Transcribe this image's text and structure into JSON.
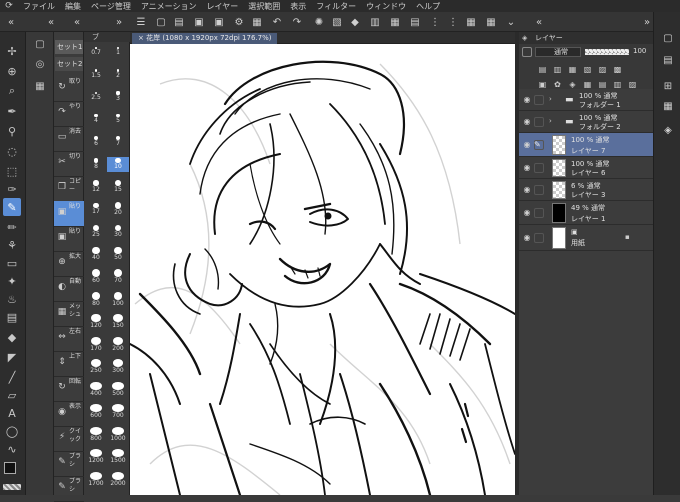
{
  "menu": [
    "ファイル",
    "編集",
    "ページ管理",
    "アニメーション",
    "レイヤー",
    "選択範囲",
    "表示",
    "フィルター",
    "ウィンドウ",
    "ヘルプ"
  ],
  "canvas_tab": "花岸 (1080 x 1920px 72dpi 176.7%)",
  "tool_property_tabs": [
    "セット1",
    "セット2"
  ],
  "sub_tools": [
    {
      "label": "取り",
      "icon": "rotate-icon"
    },
    {
      "label": "やり",
      "icon": "redo-icon"
    },
    {
      "label": "消去",
      "icon": "eraser-icon"
    },
    {
      "label": "切り",
      "icon": "scissors-icon"
    },
    {
      "label": "コピー",
      "icon": "copy-icon"
    },
    {
      "label": "貼り",
      "icon": "paste-icon",
      "active": true
    },
    {
      "label": "貼り",
      "icon": "paste-icon"
    },
    {
      "label": "拡大",
      "icon": "zoom-icon"
    },
    {
      "label": "自動",
      "icon": "auto-icon"
    },
    {
      "label": "メッシュ",
      "icon": "mesh-icon"
    },
    {
      "label": "左右",
      "icon": "flip-h-icon"
    },
    {
      "label": "上下",
      "icon": "flip-v-icon"
    },
    {
      "label": "回転",
      "icon": "rotate-icon"
    },
    {
      "label": "表示",
      "icon": "view-icon"
    },
    {
      "label": "クイック",
      "icon": "quick-icon"
    },
    {
      "label": "ブラシ",
      "icon": "brush-icon"
    },
    {
      "label": "ブラシ",
      "icon": "brush-icon"
    }
  ],
  "brush_sizes": [
    "0.7",
    "1",
    "1.5",
    "2",
    "2.5",
    "3",
    "4",
    "5",
    "6",
    "7",
    "8",
    "10",
    "12",
    "15",
    "17",
    "20",
    "25",
    "30",
    "40",
    "50",
    "60",
    "70",
    "80",
    "100",
    "120",
    "150",
    "170",
    "200",
    "250",
    "300",
    "400",
    "500",
    "600",
    "700",
    "800",
    "1000",
    "1200",
    "1500",
    "1700",
    "2000"
  ],
  "brush_selected": "10",
  "layers_title": "レイヤー",
  "blend_mode": "通常",
  "opacity": "100",
  "layers": [
    {
      "opacity": "100 %",
      "mode": "通常",
      "name": "フォルダー 1",
      "type": "folder",
      "selected": false
    },
    {
      "opacity": "100 %",
      "mode": "通常",
      "name": "フォルダー 2",
      "type": "folder",
      "selected": false
    },
    {
      "opacity": "100 %",
      "mode": "通常",
      "name": "レイヤー 7",
      "type": "raster",
      "thumb": "check",
      "selected": true
    },
    {
      "opacity": "100 %",
      "mode": "通常",
      "name": "レイヤー 6",
      "type": "raster",
      "thumb": "check",
      "selected": false
    },
    {
      "opacity": "6 %",
      "mode": "通常",
      "name": "レイヤー 3",
      "type": "raster",
      "thumb": "check",
      "selected": false
    },
    {
      "opacity": "49 %",
      "mode": "通常",
      "name": "レイヤー 1",
      "type": "raster",
      "thumb": "black",
      "selected": false
    },
    {
      "opacity": "",
      "mode": "",
      "name": "用紙",
      "type": "paper",
      "thumb": "white",
      "selected": false
    }
  ],
  "colors": {
    "accent": "#5a8dd6",
    "selected_layer": "#5a6f9c",
    "panel": "#3c3c3c",
    "canvas": "#e9e9e9"
  }
}
